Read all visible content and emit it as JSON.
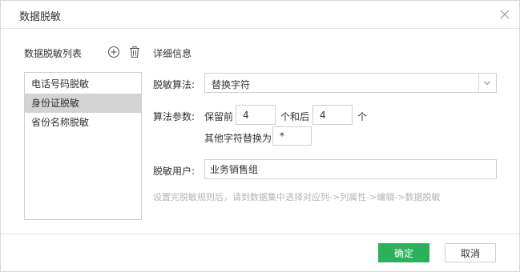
{
  "dialog": {
    "title": "数据脱敏"
  },
  "left_panel": {
    "title": "数据脱敏列表",
    "items": [
      {
        "label": "电话号码脱敏",
        "selected": false
      },
      {
        "label": "身份证脱敏",
        "selected": true
      },
      {
        "label": "省份名称脱敏",
        "selected": false
      }
    ]
  },
  "right_panel": {
    "title": "详细信息",
    "algorithm": {
      "label": "脱敏算法:",
      "value": "替换字符"
    },
    "params": {
      "label": "算法参数:",
      "keep_front_label": "保留前",
      "keep_front_value": "4",
      "and_back_label": "个和后",
      "keep_back_value": "4",
      "unit_label": "个",
      "replace_label": "其他字符替换为",
      "replace_value": "*"
    },
    "users": {
      "label": "脱敏用户:",
      "value": "业务销售组"
    },
    "hint": "设置完脱敏规则后，请到数据集中选择对应列->列属性->编辑->数据脱敏"
  },
  "footer": {
    "ok_label": "确定",
    "cancel_label": "取消"
  },
  "colors": {
    "primary": "#2bb05b",
    "selected_row": "#d4d4d4",
    "hint": "#b5b5b5"
  },
  "icons": [
    "close-icon",
    "add-circle-icon",
    "trash-icon",
    "chevron-down-icon"
  ]
}
